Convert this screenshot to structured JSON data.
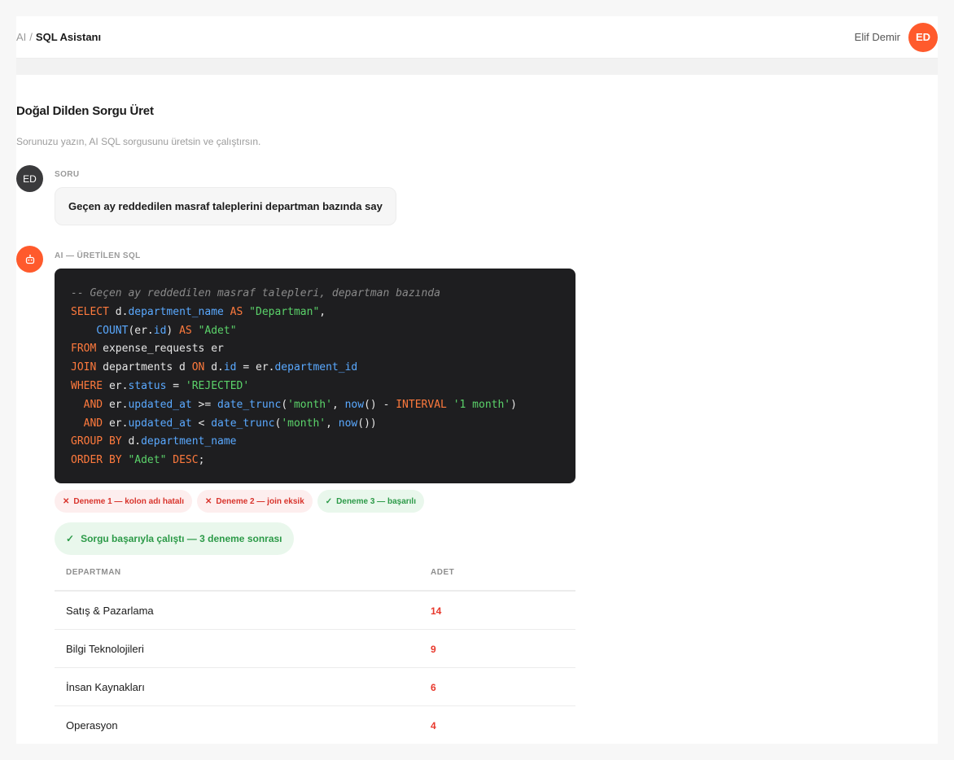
{
  "header": {
    "breadcrumb_root": "AI",
    "breadcrumb_sep": "/",
    "breadcrumb_current": "SQL Asistanı",
    "user_name": "Elif Demir",
    "user_initials": "ED"
  },
  "page": {
    "title": "Doğal Dilden Sorgu Üret",
    "subtitle": "Sorunuzu yazın, AI SQL sorgusunu üretsin ve çalıştırsın."
  },
  "question": {
    "avatar_initials": "ED",
    "label": "SORU",
    "text": "Geçen ay reddedilen masraf taleplerini departman bazında say"
  },
  "answer": {
    "avatar_icon": "robot-icon",
    "label": "AI — ÜRETİLEN SQL",
    "sql": {
      "comment": "-- Geçen ay reddedilen masraf talepleri, departman bazında",
      "l1_kw": "SELECT",
      "l1_tbl": " d.",
      "l1_fld": "department_name",
      "l1_as": " AS ",
      "l1_alias": "\"Departman\"",
      "l1_end": ",",
      "l2_fn": "    COUNT",
      "l2_a": "(er.",
      "l2_fld": "id",
      "l2_b": ") ",
      "l2_as": "AS ",
      "l2_alias": "\"Adet\"",
      "l3_kw": "FROM",
      "l3_rest": " expense_requests er",
      "l4_kw": "JOIN",
      "l4_a": " departments d ",
      "l4_on": "ON",
      "l4_b": " d.",
      "l4_fld": "id",
      "l4_c": " = er.",
      "l4_fld2": "department_id",
      "l5_kw": "WHERE",
      "l5_a": " er.",
      "l5_fld": "status",
      "l5_b": " = ",
      "l5_str": "'REJECTED'",
      "l6_kw": "  AND",
      "l6_a": " er.",
      "l6_fld": "updated_at",
      "l6_b": " >= ",
      "l6_fn": "date_trunc",
      "l6_c": "(",
      "l6_str": "'month'",
      "l6_d": ", ",
      "l6_fn2": "now",
      "l6_e": "() - ",
      "l6_kw2": "INTERVAL",
      "l6_f": " ",
      "l6_str2": "'1 month'",
      "l6_g": ")",
      "l7_kw": "  AND",
      "l7_a": " er.",
      "l7_fld": "updated_at",
      "l7_b": " < ",
      "l7_fn": "date_trunc",
      "l7_c": "(",
      "l7_str": "'month'",
      "l7_d": ", ",
      "l7_fn2": "now",
      "l7_e": "())",
      "l8_kw": "GROUP BY",
      "l8_a": " d.",
      "l8_fld": "department_name",
      "l9_kw": "ORDER BY",
      "l9_a": " ",
      "l9_str": "\"Adet\"",
      "l9_b": " ",
      "l9_kw2": "DESC",
      "l9_c": ";"
    },
    "attempts": [
      {
        "label": "Deneme 1 — kolon adı hatalı",
        "status": "fail"
      },
      {
        "label": "Deneme 2 — join eksik",
        "status": "fail"
      },
      {
        "label": "Deneme 3 — başarılı",
        "status": "ok"
      }
    ],
    "success_text": "Sorgu başarıyla çalıştı — 3 deneme sonrası"
  },
  "results": {
    "columns": [
      "DEPARTMAN",
      "ADET"
    ],
    "rows": [
      {
        "dept": "Satış & Pazarlama",
        "count": "14"
      },
      {
        "dept": "Bilgi Teknolojileri",
        "count": "9"
      },
      {
        "dept": "İnsan Kaynakları",
        "count": "6"
      },
      {
        "dept": "Operasyon",
        "count": "4"
      }
    ]
  },
  "colors": {
    "accent": "#ff5a2c",
    "danger": "#d8342c",
    "success": "#2c9a48"
  }
}
